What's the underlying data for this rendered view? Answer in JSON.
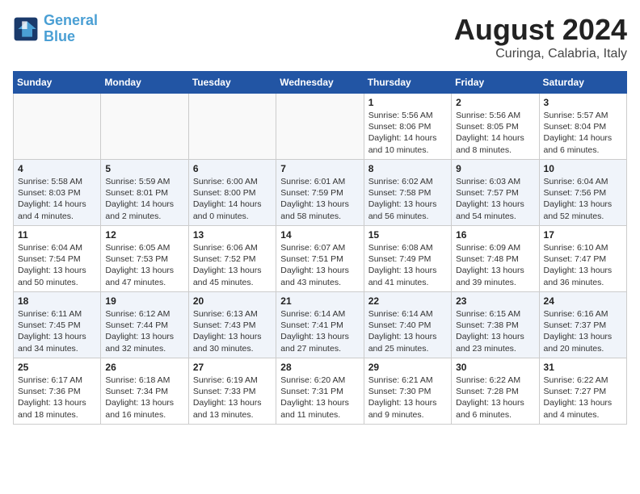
{
  "header": {
    "logo_line1": "General",
    "logo_line2": "Blue",
    "month_year": "August 2024",
    "location": "Curinga, Calabria, Italy"
  },
  "weekdays": [
    "Sunday",
    "Monday",
    "Tuesday",
    "Wednesday",
    "Thursday",
    "Friday",
    "Saturday"
  ],
  "weeks": [
    [
      {
        "day": "",
        "empty": true
      },
      {
        "day": "",
        "empty": true
      },
      {
        "day": "",
        "empty": true
      },
      {
        "day": "",
        "empty": true
      },
      {
        "day": "1",
        "sunrise": "Sunrise: 5:56 AM",
        "sunset": "Sunset: 8:06 PM",
        "daylight": "Daylight: 14 hours and 10 minutes."
      },
      {
        "day": "2",
        "sunrise": "Sunrise: 5:56 AM",
        "sunset": "Sunset: 8:05 PM",
        "daylight": "Daylight: 14 hours and 8 minutes."
      },
      {
        "day": "3",
        "sunrise": "Sunrise: 5:57 AM",
        "sunset": "Sunset: 8:04 PM",
        "daylight": "Daylight: 14 hours and 6 minutes."
      }
    ],
    [
      {
        "day": "4",
        "sunrise": "Sunrise: 5:58 AM",
        "sunset": "Sunset: 8:03 PM",
        "daylight": "Daylight: 14 hours and 4 minutes."
      },
      {
        "day": "5",
        "sunrise": "Sunrise: 5:59 AM",
        "sunset": "Sunset: 8:01 PM",
        "daylight": "Daylight: 14 hours and 2 minutes."
      },
      {
        "day": "6",
        "sunrise": "Sunrise: 6:00 AM",
        "sunset": "Sunset: 8:00 PM",
        "daylight": "Daylight: 14 hours and 0 minutes."
      },
      {
        "day": "7",
        "sunrise": "Sunrise: 6:01 AM",
        "sunset": "Sunset: 7:59 PM",
        "daylight": "Daylight: 13 hours and 58 minutes."
      },
      {
        "day": "8",
        "sunrise": "Sunrise: 6:02 AM",
        "sunset": "Sunset: 7:58 PM",
        "daylight": "Daylight: 13 hours and 56 minutes."
      },
      {
        "day": "9",
        "sunrise": "Sunrise: 6:03 AM",
        "sunset": "Sunset: 7:57 PM",
        "daylight": "Daylight: 13 hours and 54 minutes."
      },
      {
        "day": "10",
        "sunrise": "Sunrise: 6:04 AM",
        "sunset": "Sunset: 7:56 PM",
        "daylight": "Daylight: 13 hours and 52 minutes."
      }
    ],
    [
      {
        "day": "11",
        "sunrise": "Sunrise: 6:04 AM",
        "sunset": "Sunset: 7:54 PM",
        "daylight": "Daylight: 13 hours and 50 minutes."
      },
      {
        "day": "12",
        "sunrise": "Sunrise: 6:05 AM",
        "sunset": "Sunset: 7:53 PM",
        "daylight": "Daylight: 13 hours and 47 minutes."
      },
      {
        "day": "13",
        "sunrise": "Sunrise: 6:06 AM",
        "sunset": "Sunset: 7:52 PM",
        "daylight": "Daylight: 13 hours and 45 minutes."
      },
      {
        "day": "14",
        "sunrise": "Sunrise: 6:07 AM",
        "sunset": "Sunset: 7:51 PM",
        "daylight": "Daylight: 13 hours and 43 minutes."
      },
      {
        "day": "15",
        "sunrise": "Sunrise: 6:08 AM",
        "sunset": "Sunset: 7:49 PM",
        "daylight": "Daylight: 13 hours and 41 minutes."
      },
      {
        "day": "16",
        "sunrise": "Sunrise: 6:09 AM",
        "sunset": "Sunset: 7:48 PM",
        "daylight": "Daylight: 13 hours and 39 minutes."
      },
      {
        "day": "17",
        "sunrise": "Sunrise: 6:10 AM",
        "sunset": "Sunset: 7:47 PM",
        "daylight": "Daylight: 13 hours and 36 minutes."
      }
    ],
    [
      {
        "day": "18",
        "sunrise": "Sunrise: 6:11 AM",
        "sunset": "Sunset: 7:45 PM",
        "daylight": "Daylight: 13 hours and 34 minutes."
      },
      {
        "day": "19",
        "sunrise": "Sunrise: 6:12 AM",
        "sunset": "Sunset: 7:44 PM",
        "daylight": "Daylight: 13 hours and 32 minutes."
      },
      {
        "day": "20",
        "sunrise": "Sunrise: 6:13 AM",
        "sunset": "Sunset: 7:43 PM",
        "daylight": "Daylight: 13 hours and 30 minutes."
      },
      {
        "day": "21",
        "sunrise": "Sunrise: 6:14 AM",
        "sunset": "Sunset: 7:41 PM",
        "daylight": "Daylight: 13 hours and 27 minutes."
      },
      {
        "day": "22",
        "sunrise": "Sunrise: 6:14 AM",
        "sunset": "Sunset: 7:40 PM",
        "daylight": "Daylight: 13 hours and 25 minutes."
      },
      {
        "day": "23",
        "sunrise": "Sunrise: 6:15 AM",
        "sunset": "Sunset: 7:38 PM",
        "daylight": "Daylight: 13 hours and 23 minutes."
      },
      {
        "day": "24",
        "sunrise": "Sunrise: 6:16 AM",
        "sunset": "Sunset: 7:37 PM",
        "daylight": "Daylight: 13 hours and 20 minutes."
      }
    ],
    [
      {
        "day": "25",
        "sunrise": "Sunrise: 6:17 AM",
        "sunset": "Sunset: 7:36 PM",
        "daylight": "Daylight: 13 hours and 18 minutes."
      },
      {
        "day": "26",
        "sunrise": "Sunrise: 6:18 AM",
        "sunset": "Sunset: 7:34 PM",
        "daylight": "Daylight: 13 hours and 16 minutes."
      },
      {
        "day": "27",
        "sunrise": "Sunrise: 6:19 AM",
        "sunset": "Sunset: 7:33 PM",
        "daylight": "Daylight: 13 hours and 13 minutes."
      },
      {
        "day": "28",
        "sunrise": "Sunrise: 6:20 AM",
        "sunset": "Sunset: 7:31 PM",
        "daylight": "Daylight: 13 hours and 11 minutes."
      },
      {
        "day": "29",
        "sunrise": "Sunrise: 6:21 AM",
        "sunset": "Sunset: 7:30 PM",
        "daylight": "Daylight: 13 hours and 9 minutes."
      },
      {
        "day": "30",
        "sunrise": "Sunrise: 6:22 AM",
        "sunset": "Sunset: 7:28 PM",
        "daylight": "Daylight: 13 hours and 6 minutes."
      },
      {
        "day": "31",
        "sunrise": "Sunrise: 6:22 AM",
        "sunset": "Sunset: 7:27 PM",
        "daylight": "Daylight: 13 hours and 4 minutes."
      }
    ]
  ]
}
